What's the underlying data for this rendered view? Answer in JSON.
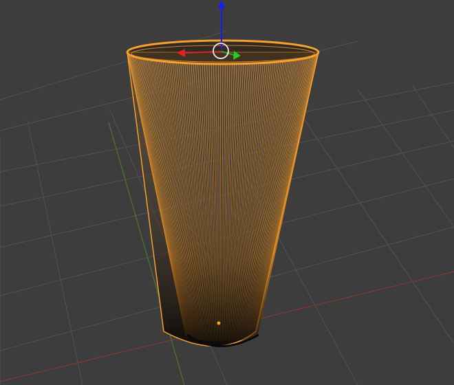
{
  "viewport": {
    "background": "#3d3d3d",
    "grid_color": "#525252",
    "axis_x_color": "#8c3434",
    "axis_y_color": "#4d7a2b",
    "axis_z_color": "#1a1aff",
    "selection_color": "#f7a12e",
    "edge_color": "#f29a25"
  },
  "selected_object": {
    "type": "cone",
    "state": "edit-mode-selected"
  },
  "gizmo": {
    "mode": "translate",
    "axes": [
      "x",
      "y",
      "z"
    ]
  }
}
